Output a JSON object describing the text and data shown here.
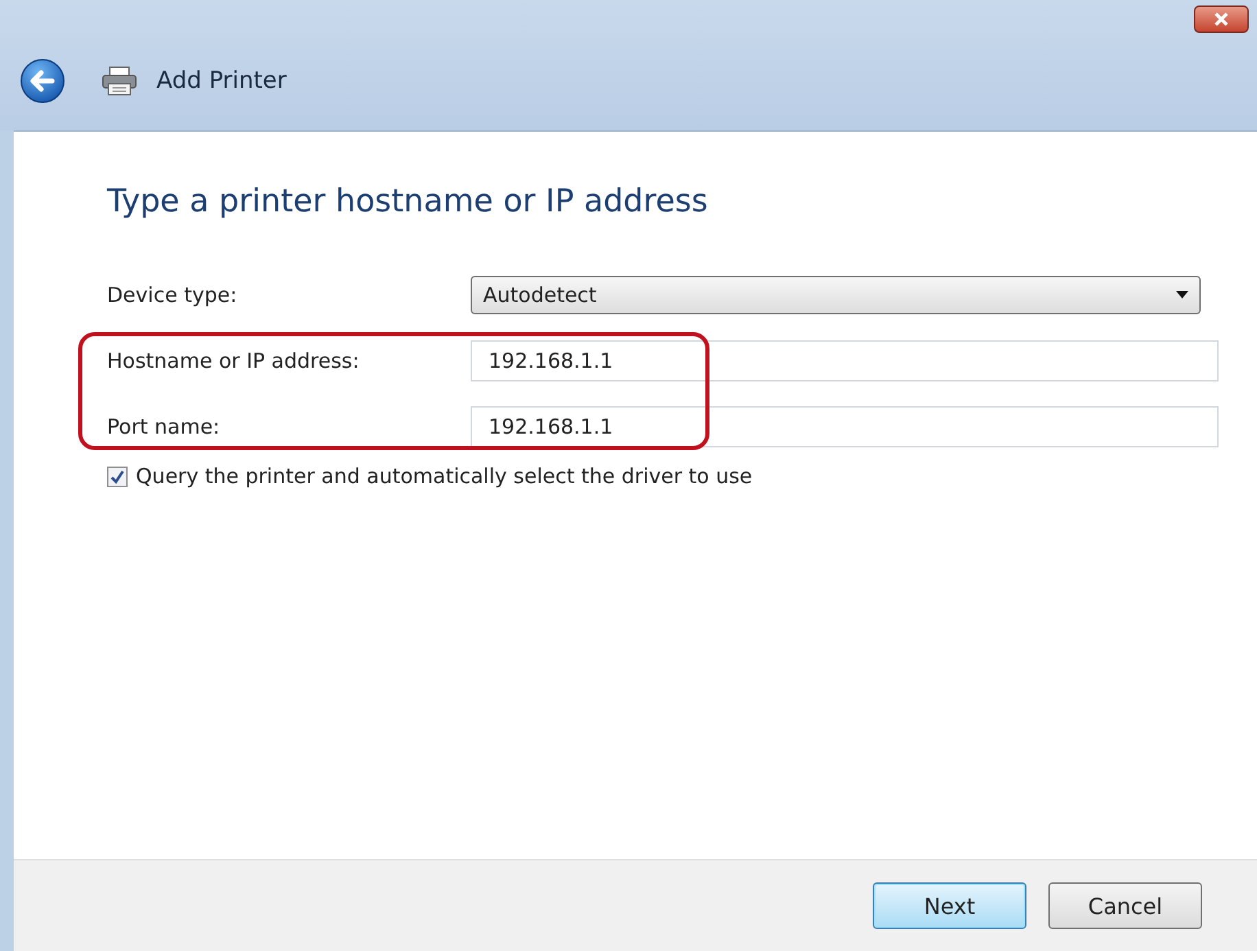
{
  "window": {
    "title": "Add Printer"
  },
  "heading": "Type a printer hostname or IP address",
  "fields": [
    {
      "kind": "dropdown",
      "label": "Device type:",
      "value": "Autodetect"
    },
    {
      "kind": "text",
      "label": "Hostname or IP address:",
      "value": "192.168.1.1"
    },
    {
      "kind": "text",
      "label": "Port name:",
      "value": "192.168.1.1"
    }
  ],
  "checkbox": {
    "label": "Query the printer and automatically select the driver to use",
    "checked": true
  },
  "buttons": [
    {
      "label": "Next",
      "default": true
    },
    {
      "label": "Cancel",
      "default": false
    }
  ]
}
